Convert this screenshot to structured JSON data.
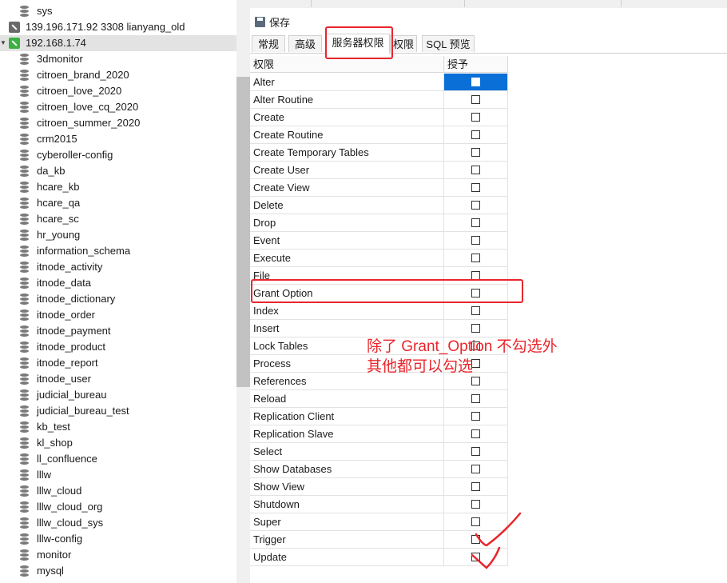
{
  "tree": {
    "top_partial_label": "sys",
    "connections": [
      {
        "label": "139.196.171.92 3308 lianyang_old",
        "color": "gray"
      },
      {
        "label": "192.168.1.74",
        "color": "green",
        "expanded": true
      }
    ],
    "databases": [
      "3dmonitor",
      "citroen_brand_2020",
      "citroen_love_2020",
      "citroen_love_cq_2020",
      "citroen_summer_2020",
      "crm2015",
      "cyberoller-config",
      "da_kb",
      "hcare_kb",
      "hcare_qa",
      "hcare_sc",
      "hr_young",
      "information_schema",
      "itnode_activity",
      "itnode_data",
      "itnode_dictionary",
      "itnode_order",
      "itnode_payment",
      "itnode_product",
      "itnode_report",
      "itnode_user",
      "judicial_bureau",
      "judicial_bureau_test",
      "kb_test",
      "kl_shop",
      "ll_confluence",
      "lllw",
      "lllw_cloud",
      "lllw_cloud_org",
      "lllw_cloud_sys",
      "lllw-config",
      "monitor",
      "mysql"
    ]
  },
  "toolbar": {
    "save_label": "保存",
    "save_icon": "save-icon"
  },
  "tabs": [
    {
      "label": "常规"
    },
    {
      "label": "高级"
    },
    {
      "label": "服务器权限",
      "active": true
    },
    {
      "label": "权限"
    },
    {
      "label": "SQL 预览"
    }
  ],
  "grid": {
    "col_privilege": "权限",
    "col_grant": "授予",
    "rows": [
      "Alter",
      "Alter Routine",
      "Create",
      "Create Routine",
      "Create Temporary Tables",
      "Create User",
      "Create View",
      "Delete",
      "Drop",
      "Event",
      "Execute",
      "File",
      "Grant Option",
      "Index",
      "Insert",
      "Lock Tables",
      "Process",
      "References",
      "Reload",
      "Replication Client",
      "Replication Slave",
      "Select",
      "Show Databases",
      "Show View",
      "Shutdown",
      "Super",
      "Trigger",
      "Update"
    ]
  },
  "annotation": {
    "line1": "除了 Grant_Option 不勾选外",
    "line2": "其他都可以勾选",
    "color": "#e8262c"
  },
  "colors": {
    "accent": "#0a6fd6",
    "highlight": "#e8262c"
  }
}
